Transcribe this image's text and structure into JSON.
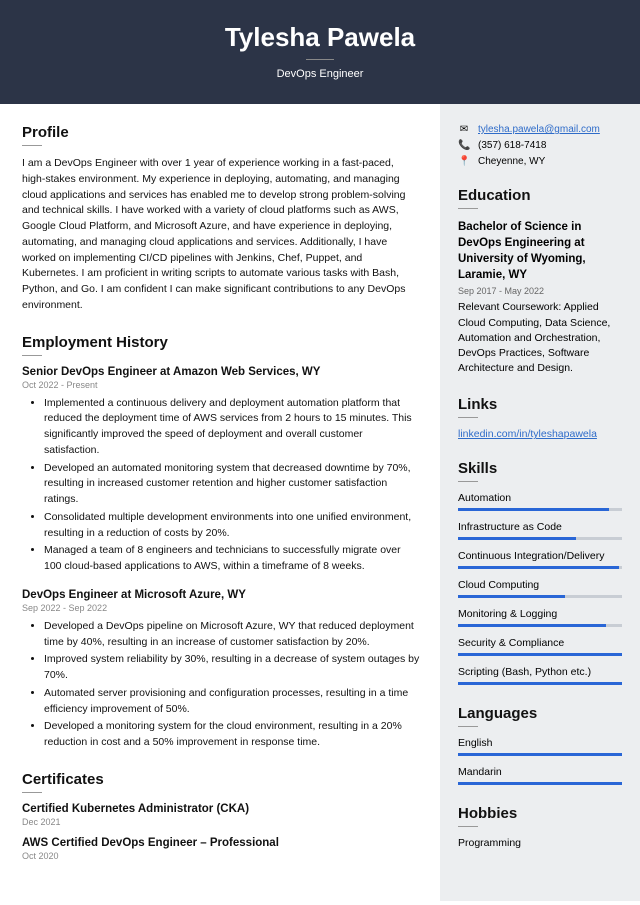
{
  "header": {
    "name": "Tylesha Pawela",
    "title": "DevOps Engineer"
  },
  "profile": {
    "heading": "Profile",
    "text": "I am a DevOps Engineer with over 1 year of experience working in a fast-paced, high-stakes environment. My experience in deploying, automating, and managing cloud applications and services has enabled me to develop strong problem-solving and technical skills. I have worked with a variety of cloud platforms such as AWS, Google Cloud Platform, and Microsoft Azure, and have experience in deploying, automating, and managing cloud applications and services. Additionally, I have worked on implementing CI/CD pipelines with Jenkins, Chef, Puppet, and Kubernetes. I am proficient in writing scripts to automate various tasks with Bash, Python, and Go. I am confident I can make significant contributions to any DevOps environment."
  },
  "employment": {
    "heading": "Employment History",
    "jobs": [
      {
        "title": "Senior DevOps Engineer at Amazon Web Services, WY",
        "dates": "Oct 2022 - Present",
        "bullets": [
          "Implemented a continuous delivery and deployment automation platform that reduced the deployment time of AWS services from 2 hours to 15 minutes. This significantly improved the speed of deployment and overall customer satisfaction.",
          "Developed an automated monitoring system that decreased downtime by 70%, resulting in increased customer retention and higher customer satisfaction ratings.",
          "Consolidated multiple development environments into one unified environment, resulting in a reduction of costs by 20%.",
          "Managed a team of 8 engineers and technicians to successfully migrate over 100 cloud-based applications to AWS, within a timeframe of 8 weeks."
        ]
      },
      {
        "title": "DevOps Engineer at Microsoft Azure, WY",
        "dates": "Sep 2022 - Sep 2022",
        "bullets": [
          "Developed a DevOps pipeline on Microsoft Azure, WY that reduced deployment time by 40%, resulting in an increase of customer satisfaction by 20%.",
          "Improved system reliability by 30%, resulting in a decrease of system outages by 70%.",
          "Automated server provisioning and configuration processes, resulting in a time efficiency improvement of 50%.",
          "Developed a monitoring system for the cloud environment, resulting in a 20% reduction in cost and a 50% improvement in response time."
        ]
      }
    ]
  },
  "certificates": {
    "heading": "Certificates",
    "items": [
      {
        "title": "Certified Kubernetes Administrator (CKA)",
        "date": "Dec 2021"
      },
      {
        "title": "AWS Certified DevOps Engineer – Professional",
        "date": "Oct 2020"
      }
    ]
  },
  "contact": {
    "email": "tylesha.pawela@gmail.com",
    "phone": "(357) 618-7418",
    "location": "Cheyenne, WY"
  },
  "education": {
    "heading": "Education",
    "title": "Bachelor of Science in DevOps Engineering at University of Wyoming, Laramie, WY",
    "dates": "Sep 2017 - May 2022",
    "text": "Relevant Coursework: Applied Cloud Computing, Data Science, Automation and Orchestration, DevOps Practices, Software Architecture and Design."
  },
  "links": {
    "heading": "Links",
    "items": [
      "linkedin.com/in/tyleshapawela"
    ]
  },
  "skills": {
    "heading": "Skills",
    "items": [
      {
        "name": "Automation",
        "level": 92
      },
      {
        "name": "Infrastructure as Code",
        "level": 72
      },
      {
        "name": "Continuous Integration/Delivery",
        "level": 98
      },
      {
        "name": "Cloud Computing",
        "level": 65
      },
      {
        "name": "Monitoring & Logging",
        "level": 90
      },
      {
        "name": "Security & Compliance",
        "level": 100
      },
      {
        "name": "Scripting (Bash, Python etc.)",
        "level": 100
      }
    ]
  },
  "languages": {
    "heading": "Languages",
    "items": [
      {
        "name": "English",
        "level": 100
      },
      {
        "name": "Mandarin",
        "level": 100
      }
    ]
  },
  "hobbies": {
    "heading": "Hobbies",
    "items": [
      "Programming"
    ]
  }
}
